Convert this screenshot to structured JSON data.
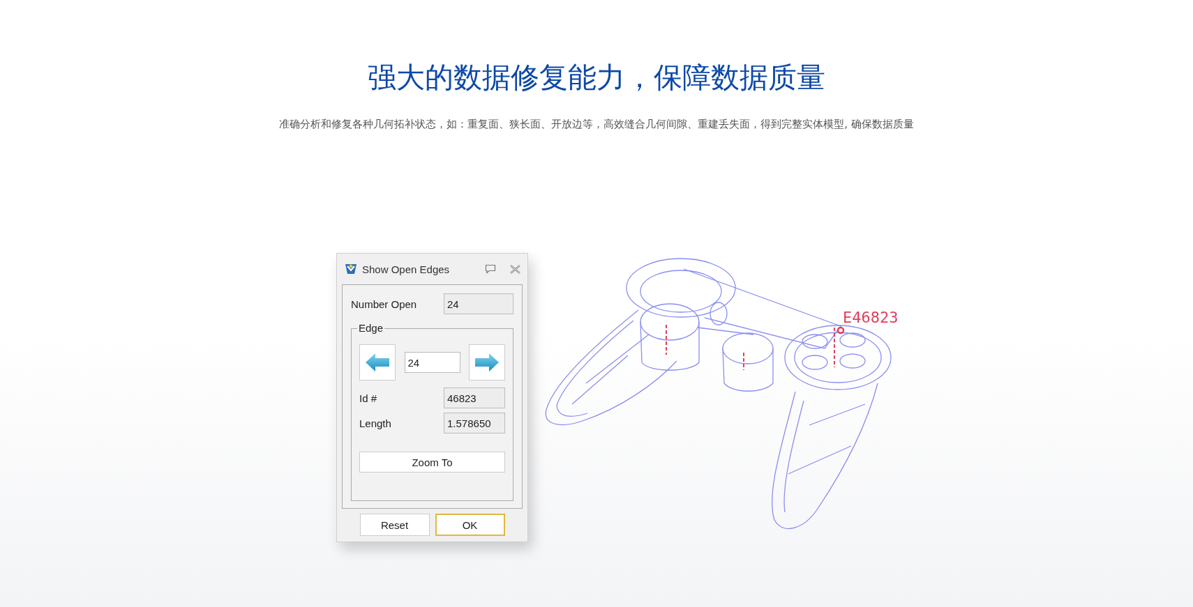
{
  "heading": "强大的数据修复能力，保障数据质量",
  "subtitle": "准确分析和修复各种几何拓补状态，如：重复面、狭长面、开放边等，高效缝合几何间隙、重建丢失面，得到完整实体模型, 确保数据质量",
  "dialog": {
    "title": "Show Open Edges",
    "number_open": {
      "label": "Number Open",
      "value": "24",
      "readonly": true
    },
    "edge_group": {
      "legend": "Edge",
      "current_edge": {
        "value": "24",
        "readonly": false
      },
      "fields": [
        {
          "label": "Id #",
          "value": "46823",
          "readonly": true
        },
        {
          "label": "Length",
          "value": "1.578650",
          "readonly": true
        }
      ],
      "zoom_button": "Zoom To"
    },
    "buttons": [
      {
        "label": "Reset",
        "default": false
      },
      {
        "label": "OK",
        "default": true
      }
    ]
  },
  "model_label": "E46823"
}
